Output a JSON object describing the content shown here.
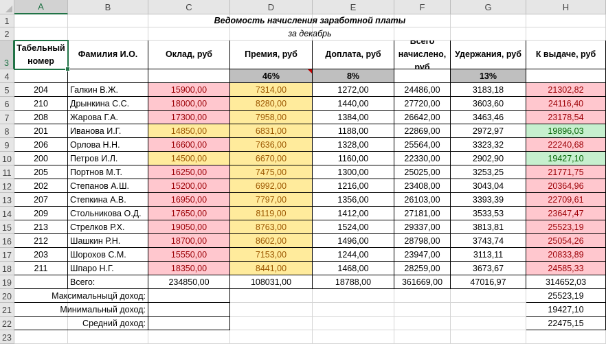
{
  "columns": [
    "A",
    "B",
    "C",
    "D",
    "E",
    "F",
    "G",
    "H"
  ],
  "rows": [
    "1",
    "2",
    "3",
    "4",
    "5",
    "6",
    "7",
    "8",
    "9",
    "10",
    "11",
    "12",
    "13",
    "14",
    "15",
    "16",
    "17",
    "18",
    "19",
    "20",
    "21",
    "22",
    "23"
  ],
  "title": "Ведомость начисления заработной платы",
  "subtitle": "за декабрь",
  "headers": {
    "tab": "Табельный номер",
    "name": "Фамилия И.О.",
    "salary": "Оклад, руб",
    "bonus": "Премия, руб",
    "extra": "Доплата, руб",
    "total": "Всего начислено, руб",
    "deduct": "Удержания, руб",
    "payout": "К выдаче, руб"
  },
  "rates": {
    "bonus": "46%",
    "extra": "8%",
    "deduct": "13%"
  },
  "employees": [
    {
      "id": "204",
      "name": "Галкин В.Ж.",
      "salary": "15900,00",
      "bonus": "7314,00",
      "extra": "1272,00",
      "total": "24486,00",
      "deduct": "3183,18",
      "payout": "21302,82",
      "sfill": "pink",
      "bfill": "yellow",
      "pfill": "pink"
    },
    {
      "id": "210",
      "name": "Дрынкина С.С.",
      "salary": "18000,00",
      "bonus": "8280,00",
      "extra": "1440,00",
      "total": "27720,00",
      "deduct": "3603,60",
      "payout": "24116,40",
      "sfill": "pink",
      "bfill": "yellow",
      "pfill": "pink"
    },
    {
      "id": "208",
      "name": "Жарова Г.А.",
      "salary": "17300,00",
      "bonus": "7958,00",
      "extra": "1384,00",
      "total": "26642,00",
      "deduct": "3463,46",
      "payout": "23178,54",
      "sfill": "pink",
      "bfill": "yellow",
      "pfill": "pink"
    },
    {
      "id": "201",
      "name": "Иванова И.Г.",
      "salary": "14850,00",
      "bonus": "6831,00",
      "extra": "1188,00",
      "total": "22869,00",
      "deduct": "2972,97",
      "payout": "19896,03",
      "sfill": "yellow",
      "bfill": "yellow",
      "pfill": "green"
    },
    {
      "id": "206",
      "name": "Орлова Н.Н.",
      "salary": "16600,00",
      "bonus": "7636,00",
      "extra": "1328,00",
      "total": "25564,00",
      "deduct": "3323,32",
      "payout": "22240,68",
      "sfill": "pink",
      "bfill": "yellow",
      "pfill": "pink"
    },
    {
      "id": "200",
      "name": "Петров И.Л.",
      "salary": "14500,00",
      "bonus": "6670,00",
      "extra": "1160,00",
      "total": "22330,00",
      "deduct": "2902,90",
      "payout": "19427,10",
      "sfill": "yellow",
      "bfill": "yellow",
      "pfill": "green"
    },
    {
      "id": "205",
      "name": "Портнов М.Т.",
      "salary": "16250,00",
      "bonus": "7475,00",
      "extra": "1300,00",
      "total": "25025,00",
      "deduct": "3253,25",
      "payout": "21771,75",
      "sfill": "pink",
      "bfill": "yellow",
      "pfill": "pink"
    },
    {
      "id": "202",
      "name": "Степанов А.Ш.",
      "salary": "15200,00",
      "bonus": "6992,00",
      "extra": "1216,00",
      "total": "23408,00",
      "deduct": "3043,04",
      "payout": "20364,96",
      "sfill": "pink",
      "bfill": "yellow",
      "pfill": "pink"
    },
    {
      "id": "207",
      "name": "Степкина А.В.",
      "salary": "16950,00",
      "bonus": "7797,00",
      "extra": "1356,00",
      "total": "26103,00",
      "deduct": "3393,39",
      "payout": "22709,61",
      "sfill": "pink",
      "bfill": "yellow",
      "pfill": "pink"
    },
    {
      "id": "209",
      "name": "Стольникова О.Д.",
      "salary": "17650,00",
      "bonus": "8119,00",
      "extra": "1412,00",
      "total": "27181,00",
      "deduct": "3533,53",
      "payout": "23647,47",
      "sfill": "pink",
      "bfill": "yellow",
      "pfill": "pink"
    },
    {
      "id": "213",
      "name": "Стрелков Р.Х.",
      "salary": "19050,00",
      "bonus": "8763,00",
      "extra": "1524,00",
      "total": "29337,00",
      "deduct": "3813,81",
      "payout": "25523,19",
      "sfill": "pink",
      "bfill": "yellow",
      "pfill": "pink"
    },
    {
      "id": "212",
      "name": "Шашкин Р.Н.",
      "salary": "18700,00",
      "bonus": "8602,00",
      "extra": "1496,00",
      "total": "28798,00",
      "deduct": "3743,74",
      "payout": "25054,26",
      "sfill": "pink",
      "bfill": "yellow",
      "pfill": "pink"
    },
    {
      "id": "203",
      "name": "Шорохов С.М.",
      "salary": "15550,00",
      "bonus": "7153,00",
      "extra": "1244,00",
      "total": "23947,00",
      "deduct": "3113,11",
      "payout": "20833,89",
      "sfill": "pink",
      "bfill": "yellow",
      "pfill": "pink"
    },
    {
      "id": "211",
      "name": "Шпаро Н.Г.",
      "salary": "18350,00",
      "bonus": "8441,00",
      "extra": "1468,00",
      "total": "28259,00",
      "deduct": "3673,67",
      "payout": "24585,33",
      "sfill": "pink",
      "bfill": "yellow",
      "pfill": "pink"
    }
  ],
  "totals": {
    "label": "Всего:",
    "salary": "234850,00",
    "bonus": "108031,00",
    "extra": "18788,00",
    "total": "361669,00",
    "deduct": "47016,97",
    "payout": "314652,03"
  },
  "summary": [
    {
      "label": "Максимальныцй доход:",
      "value": "25523,19"
    },
    {
      "label": "Минимальный доход:",
      "value": "19427,10"
    },
    {
      "label": "Средний доход:",
      "value": "22475,15"
    }
  ],
  "colors": {
    "pink_fill": "#ffc7ce",
    "pink_text": "#9c0006",
    "yellow_fill": "#ffeb9c",
    "yellow_text": "#9c5700",
    "green_fill": "#c6efce",
    "green_text": "#006100",
    "selection": "#217346"
  }
}
